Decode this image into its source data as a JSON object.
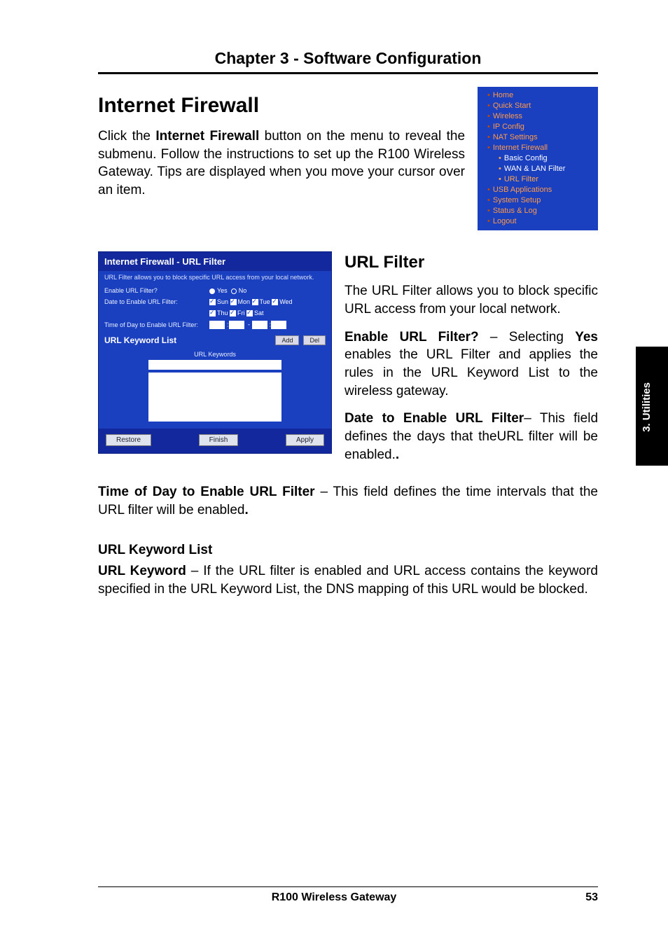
{
  "chapter_header": "Chapter 3 - Software Configuration",
  "section_title": "Internet Firewall",
  "intro_html": "Click the <b>Internet Firewall</b> button on the menu to reveal the submenu. Follow the instructions to set up the R100 Wireless Gateway. Tips are displayed when you move your cursor over an item.",
  "nav": {
    "items": [
      {
        "label": "Home",
        "class": "top bullet"
      },
      {
        "label": "Quick Start",
        "class": "top bullet"
      },
      {
        "label": "Wireless",
        "class": "top bullet"
      },
      {
        "label": "IP Config",
        "class": "top bullet"
      },
      {
        "label": "NAT Settings",
        "class": "top bullet"
      },
      {
        "label": "Internet Firewall",
        "class": "top bullet"
      },
      {
        "label": "Basic Config",
        "class": "nav-sub"
      },
      {
        "label": "WAN & LAN Filter",
        "class": "nav-sub"
      },
      {
        "label": "URL Filter",
        "class": "nav-sub active"
      },
      {
        "label": "USB Applications",
        "class": "top bullet"
      },
      {
        "label": "System Setup",
        "class": "top bullet"
      },
      {
        "label": "Status & Log",
        "class": "top bullet"
      },
      {
        "label": "Logout",
        "class": "top bullet"
      }
    ]
  },
  "filterbox": {
    "title": "Internet Firewall - URL Filter",
    "desc": "URL Filter allows you to block specific URL access from your local network.",
    "rows": {
      "enable_label": "Enable URL Filter?",
      "enable_yes": "Yes",
      "enable_no": "No",
      "date_label": "Date to Enable URL Filter:",
      "days_line1": [
        "Sun",
        "Mon",
        "Tue",
        "Wed"
      ],
      "days_line2": [
        "Thu",
        "Fri",
        "Sat"
      ],
      "time_label": "Time of Day to Enable URL Filter:"
    },
    "klist_label": "URL Keyword List",
    "klist_caption": "URL Keywords",
    "btn_add": "Add",
    "btn_del": "Del",
    "btn_restore": "Restore",
    "btn_finish": "Finish",
    "btn_apply": "Apply"
  },
  "url_filter": {
    "heading": "URL Filter",
    "p1": "The URL Filter allows you to block specific URL access from your local network.",
    "p2_html": "<b>Enable URL Filter?</b> – Selecting <b>Yes</b> enables the URL Filter and applies the rules in  the URL Keyword List to the wireless gateway.",
    "p3_html": "<b>Date to Enable URL Filter</b>– This field defines the days that theURL filter will be enabled.<b>.</b>"
  },
  "time_para_html": "<b>Time of Day to Enable URL Filter</b> – This field defines the time intervals that the URL filter will be enabled<b>.</b>",
  "keyword_section": {
    "heading": "URL Keyword List",
    "para_html": "<b>URL Keyword</b> – If the URL filter is enabled and URL access contains the keyword specified in the URL Keyword List, the DNS mapping of this URL would be blocked."
  },
  "side_tab": "3. Utilities",
  "footer": {
    "title": "R100 Wireless Gateway",
    "page": "53"
  }
}
